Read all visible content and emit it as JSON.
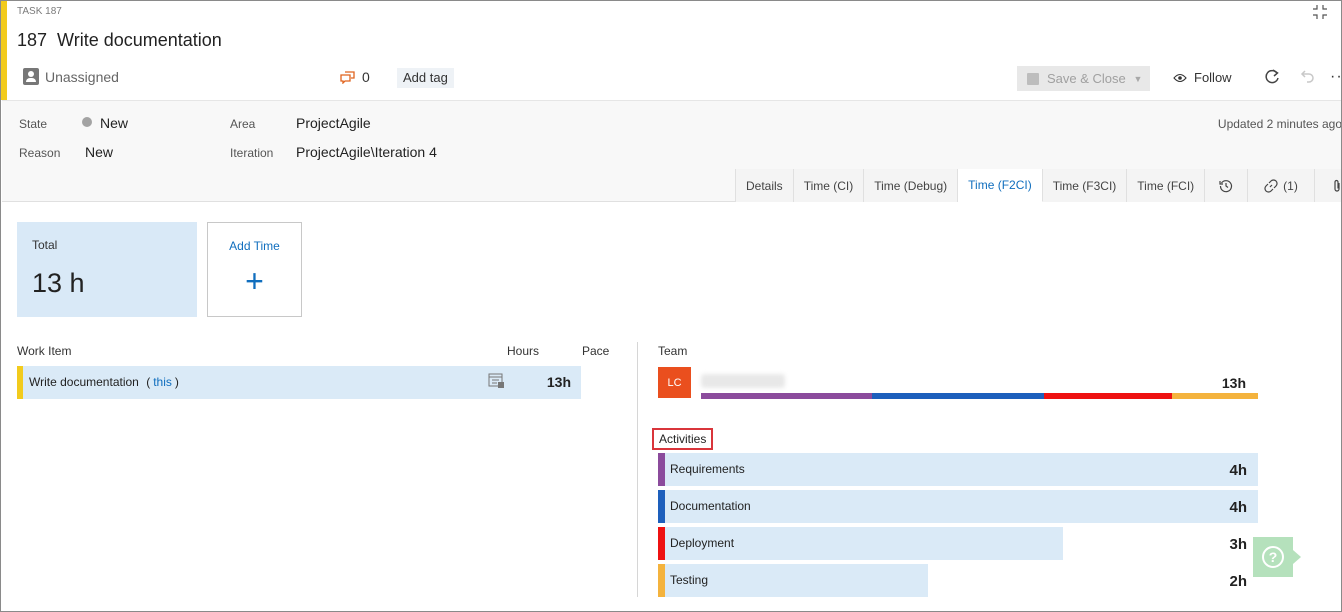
{
  "header": {
    "task_type": "TASK 187",
    "id": "187",
    "title": "Write documentation",
    "assigned_to": "Unassigned",
    "discussion_count": "0",
    "add_tag": "Add tag",
    "save_close": "Save & Close",
    "follow": "Follow",
    "accent_color": "#f2cb1d"
  },
  "fields": {
    "state_label": "State",
    "state_value": "New",
    "reason_label": "Reason",
    "reason_value": "New",
    "area_label": "Area",
    "area_value": "ProjectAgile",
    "iteration_label": "Iteration",
    "iteration_value": "ProjectAgile\\Iteration 4",
    "updated": "Updated 2 minutes ago"
  },
  "tabs": [
    {
      "label": "Details"
    },
    {
      "label": "Time (CI)"
    },
    {
      "label": "Time (Debug)"
    },
    {
      "label": "Time (F2CI)",
      "active": true
    },
    {
      "label": "Time (F3CI)"
    },
    {
      "label": "Time (FCI)"
    },
    {
      "label": "",
      "icon": "history-icon"
    },
    {
      "label": "(1)",
      "icon": "link-icon"
    },
    {
      "label": "",
      "icon": "attachment-icon"
    }
  ],
  "summary": {
    "total_label": "Total",
    "total_value": "13 h",
    "add_time_label": "Add Time",
    "add_time_symbol": "+"
  },
  "work_items": {
    "col_work_item": "Work Item",
    "col_hours": "Hours",
    "col_pace": "Pace",
    "rows": [
      {
        "name": "Write documentation",
        "this_open": "(",
        "this_link": "this",
        "this_close": ")",
        "hours": "13h"
      }
    ]
  },
  "team": {
    "label": "Team",
    "members": [
      {
        "initials": "LC",
        "avatar_color": "#ea4f1e",
        "hours": "13h"
      }
    ],
    "breakdown": [
      {
        "color": "#8b4b9c",
        "value": 4
      },
      {
        "color": "#1d5fbc",
        "value": 4
      },
      {
        "color": "#ee1111",
        "value": 3
      },
      {
        "color": "#f4b33d",
        "value": 2
      }
    ]
  },
  "activities": {
    "label": "Activities",
    "max_hours": 4,
    "items": [
      {
        "name": "Requirements",
        "hours": "4h",
        "value": 4,
        "color": "#8b4b9c"
      },
      {
        "name": "Documentation",
        "hours": "4h",
        "value": 4,
        "color": "#1d5fbc"
      },
      {
        "name": "Deployment",
        "hours": "3h",
        "value": 3,
        "color": "#ee1111"
      },
      {
        "name": "Testing",
        "hours": "2h",
        "value": 2,
        "color": "#f4b33d"
      }
    ]
  },
  "help": {
    "symbol": "?"
  }
}
